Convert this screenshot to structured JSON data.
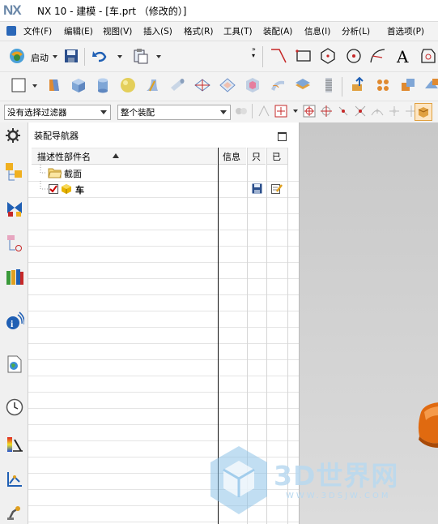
{
  "window": {
    "logo": "NX",
    "title": "NX 10 - 建模 - [车.prt （修改的）]"
  },
  "menu": {
    "items": [
      "文件(F)",
      "编辑(E)",
      "视图(V)",
      "插入(S)",
      "格式(R)",
      "工具(T)",
      "装配(A)",
      "信息(I)",
      "分析(L)",
      "首选项(P)"
    ]
  },
  "toolbar": {
    "start_label": "启动",
    "text_tool": "A"
  },
  "filters": {
    "selection_filter": "没有选择过滤器",
    "assembly_scope": "整个装配"
  },
  "navigator": {
    "title": "装配导航器",
    "columns": {
      "name": "描述性部件名",
      "info": "信息",
      "readonly": "只",
      "modified": "已"
    },
    "nodes": [
      {
        "label": "截面",
        "checked": false
      },
      {
        "label": "车",
        "checked": true
      }
    ]
  },
  "watermark": {
    "brand": "3D世界网",
    "url": "WWW.3DSJW.COM"
  },
  "colors": {
    "accent": "#1f5fb4",
    "check": "#cc0000",
    "part": "#e8b400",
    "model": "#e06a10",
    "watermark": "#8ec3e8"
  }
}
